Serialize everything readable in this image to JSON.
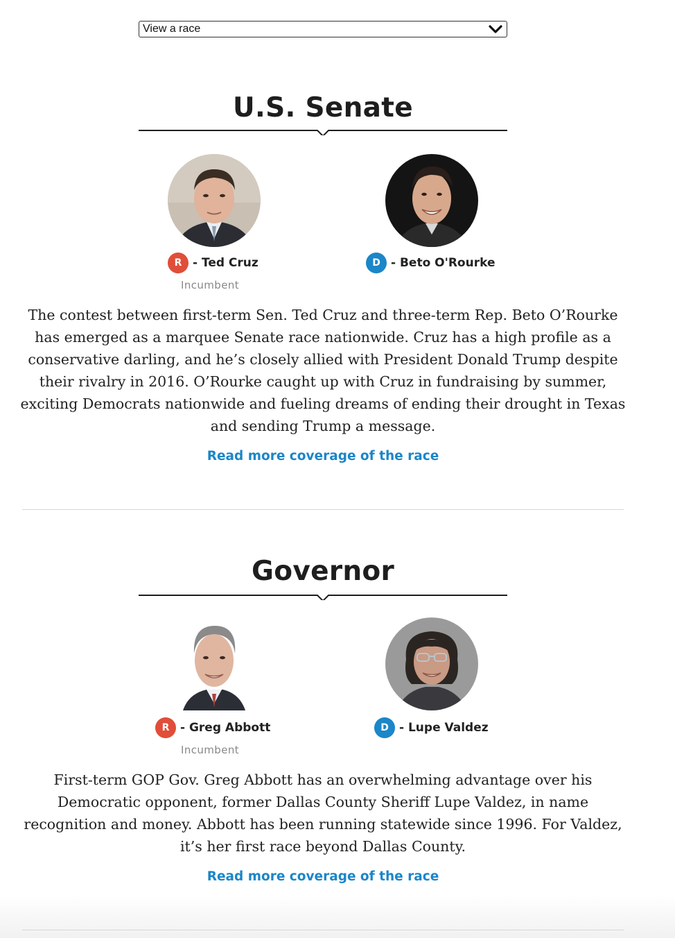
{
  "race_selector": {
    "label": "View a race",
    "icon": "chevron-down-icon"
  },
  "races": [
    {
      "title": "U.S. Senate",
      "candidates": [
        {
          "party": "R",
          "name_text": "- Ted Cruz",
          "incumbent_label": "Incumbent",
          "party_color": "#e04e39"
        },
        {
          "party": "D",
          "name_text": "- Beto O'Rourke",
          "incumbent_label": "",
          "party_color": "#1b86c8"
        }
      ],
      "description": "The contest between first-term Sen. Ted Cruz and three-term Rep. Beto O’Rourke has emerged as a marquee Senate race nationwide. Cruz has a high profile as a conservative darling, and he’s closely allied with President Donald Trump despite their rivalry in 2016. O’Rourke caught up with Cruz in fundraising by summer, exciting Democrats nationwide and fueling dreams of ending their drought in Texas and sending Trump a message.",
      "read_more": "Read more coverage of the race"
    },
    {
      "title": "Governor",
      "candidates": [
        {
          "party": "R",
          "name_text": "- Greg Abbott",
          "incumbent_label": "Incumbent",
          "party_color": "#e04e39"
        },
        {
          "party": "D",
          "name_text": "- Lupe Valdez",
          "incumbent_label": "",
          "party_color": "#1b86c8"
        }
      ],
      "description": "First-term GOP Gov. Greg Abbott has an overwhelming advantage over his Democratic opponent, former Dallas County Sheriff Lupe Valdez, in name recognition and money. Abbott has been running statewide since 1996. For Valdez, it’s her first race beyond Dallas County.",
      "read_more": "Read more coverage of the race"
    }
  ],
  "colors": {
    "republican": "#e04e39",
    "democrat": "#1b86c8",
    "link": "#1b86c8",
    "text": "#222222",
    "muted": "#888888"
  }
}
